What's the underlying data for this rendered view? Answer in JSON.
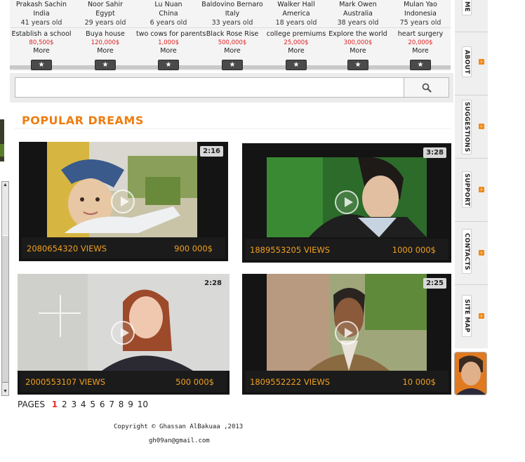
{
  "dreamers": [
    {
      "name": "Prakash Sachin",
      "country": "India",
      "age": "41 years old",
      "dream": "Establish a school",
      "price": "80,500$",
      "more": "More"
    },
    {
      "name": "Noor  Sahir",
      "country": "Egypt",
      "age": "29 years old",
      "dream": "Buya house",
      "price": "120,000$",
      "more": "More"
    },
    {
      "name": "Lu  Nuan",
      "country": "China",
      "age": "6 years old",
      "dream": "two cows for parents",
      "price": "1,000$",
      "more": "More"
    },
    {
      "name": "Baldovino  Bernaro",
      "country": "Italy",
      "age": "33 years old",
      "dream": "Black Rose Rise",
      "price": "500,000$",
      "more": "More"
    },
    {
      "name": "Walker  Hall",
      "country": "America",
      "age": "18 years old",
      "dream": "college premiums",
      "price": "25,000$",
      "more": "More"
    },
    {
      "name": "Mark Owen",
      "country": "Australia",
      "age": "38 years old",
      "dream": "Explore the world",
      "price": "300,000$",
      "more": "More"
    },
    {
      "name": "Mulan Yao",
      "country": "Indonesia",
      "age": "75 years old",
      "dream": "heart surgery",
      "price": "20,000$",
      "more": "More"
    }
  ],
  "star_glyph": "★",
  "search": {
    "placeholder": "",
    "value": ""
  },
  "section_title": "POPULAR DREAMS",
  "videos": [
    {
      "duration": "2:16",
      "views": "2080654320 VIEWS",
      "amount": "900 000$"
    },
    {
      "duration": "3:28",
      "views": "1889553205 VIEWS",
      "amount": "1000 000$"
    },
    {
      "duration": "2:28",
      "views": "2000553107 VIEWS",
      "amount": "500 000$"
    },
    {
      "duration": "2:25",
      "views": "1809552222 VIEWS",
      "amount": "10 000$"
    }
  ],
  "pagination": {
    "label": "PAGES",
    "pages": [
      "1",
      "2",
      "3",
      "4",
      "5",
      "6",
      "7",
      "8",
      "9",
      "10"
    ],
    "active": "1"
  },
  "footer": {
    "copyright": "Copyright © Ghassan AlBakuaa ,2013",
    "email": "gh09an@gmail.com"
  },
  "sidebar": {
    "items": [
      {
        "label": "ME"
      },
      {
        "label": "ABOUT"
      },
      {
        "label": "SUGGESTIONS"
      },
      {
        "label": "SUPPORT"
      },
      {
        "label": "CONTACTS"
      },
      {
        "label": "SITE MAP"
      }
    ],
    "dot_glyph": "›"
  },
  "colors": {
    "accent": "#ef7d10",
    "price": "#dd2222",
    "stats": "#f0a020",
    "active_page": "#e0302c"
  }
}
